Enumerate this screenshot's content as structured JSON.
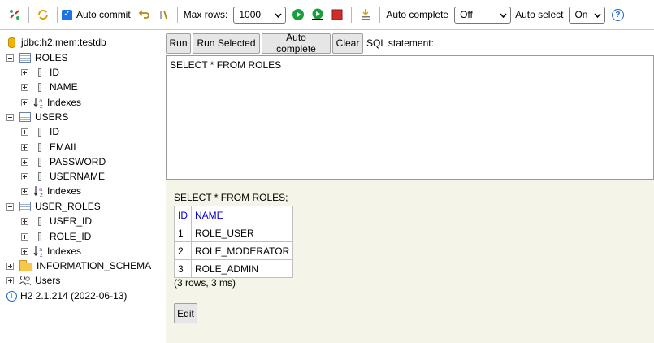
{
  "toolbar": {
    "auto_commit_label": "Auto commit",
    "max_rows_label": "Max rows:",
    "max_rows_value": "1000",
    "auto_complete_label": "Auto complete",
    "auto_complete_value": "Off",
    "auto_select_label": "Auto select",
    "auto_select_value": "On",
    "help_glyph": "?"
  },
  "tree": {
    "connection": "jdbc:h2:mem:testdb",
    "tables": [
      {
        "name": "ROLES",
        "columns": [
          "ID",
          "NAME"
        ],
        "indexes": "Indexes"
      },
      {
        "name": "USERS",
        "columns": [
          "ID",
          "EMAIL",
          "PASSWORD",
          "USERNAME"
        ],
        "indexes": "Indexes"
      },
      {
        "name": "USER_ROLES",
        "columns": [
          "USER_ID",
          "ROLE_ID"
        ],
        "indexes": "Indexes"
      }
    ],
    "schema": "INFORMATION_SCHEMA",
    "users": "Users",
    "version": "H2 2.1.214 (2022-06-13)"
  },
  "query": {
    "run": "Run",
    "run_selected": "Run Selected",
    "auto_complete": "Auto complete",
    "clear": "Clear",
    "sql_label": "SQL statement:",
    "sql": "SELECT * FROM ROLES"
  },
  "result": {
    "statement": "SELECT * FROM ROLES;",
    "headers": [
      "ID",
      "NAME"
    ],
    "rows": [
      [
        "1",
        "ROLE_USER"
      ],
      [
        "2",
        "ROLE_MODERATOR"
      ],
      [
        "3",
        "ROLE_ADMIN"
      ]
    ],
    "count": "(3 rows, 3 ms)",
    "edit": "Edit"
  },
  "colors": {
    "accent": "#1a73e8",
    "result_bg": "#f4f4e8",
    "header_text": "#0000cc",
    "run_green": "#1b9e3e",
    "stop_red": "#d22d2d"
  }
}
